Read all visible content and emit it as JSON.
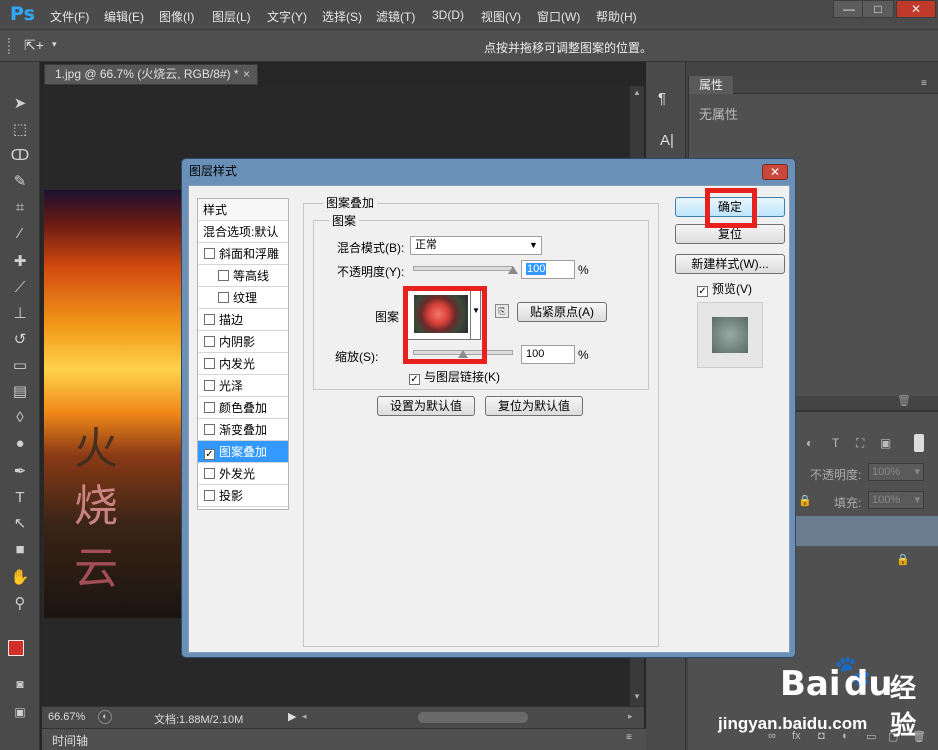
{
  "app": {
    "logo": "Ps"
  },
  "menu": [
    "文件(F)",
    "编辑(E)",
    "图像(I)",
    "图层(L)",
    "文字(Y)",
    "选择(S)",
    "滤镜(T)",
    "3D(D)",
    "视图(V)",
    "窗口(W)",
    "帮助(H)"
  ],
  "window_controls": {
    "minimize": "—",
    "maximize": "□",
    "close": "✕"
  },
  "options_bar": {
    "hint": "点按并拖移可调整图案的位置。"
  },
  "document": {
    "tab_title": "1.jpg @ 66.7% (火烧云, RGB/8#) *",
    "tab_close": "×",
    "canvas_text": [
      "火",
      "烧",
      "云"
    ]
  },
  "status": {
    "zoom": "66.67%",
    "doc_info": "文档:1.88M/2.10M"
  },
  "timeline": {
    "label": "时间轴"
  },
  "properties": {
    "tab": "属性",
    "empty": "无属性"
  },
  "layers": {
    "opacity_label": "不透明度:",
    "opacity_value": "100%",
    "fill_label": "填充:",
    "fill_value": "100%"
  },
  "dialog": {
    "title": "图层样式",
    "close": "✕",
    "styles_header": "样式",
    "blend_options": "混合选项:默认",
    "styles": [
      {
        "label": "斜面和浮雕",
        "checked": false,
        "sub": false
      },
      {
        "label": "等高线",
        "checked": false,
        "sub": true
      },
      {
        "label": "纹理",
        "checked": false,
        "sub": true
      },
      {
        "label": "描边",
        "checked": false,
        "sub": false
      },
      {
        "label": "内阴影",
        "checked": false,
        "sub": false
      },
      {
        "label": "内发光",
        "checked": false,
        "sub": false
      },
      {
        "label": "光泽",
        "checked": false,
        "sub": false
      },
      {
        "label": "颜色叠加",
        "checked": false,
        "sub": false
      },
      {
        "label": "渐变叠加",
        "checked": false,
        "sub": false
      },
      {
        "label": "图案叠加",
        "checked": true,
        "sub": false,
        "selected": true
      },
      {
        "label": "外发光",
        "checked": false,
        "sub": false
      },
      {
        "label": "投影",
        "checked": false,
        "sub": false
      }
    ],
    "section_title": "图案叠加",
    "group_title": "图案",
    "blend_mode_label": "混合模式(B):",
    "blend_mode_value": "正常",
    "opacity_label": "不透明度(Y):",
    "opacity_value": "100",
    "opacity_unit": "%",
    "opacity_level": 1.0,
    "pattern_label": "图案",
    "snap_button": "贴紧原点(A)",
    "scale_label": "缩放(S):",
    "scale_value": "100",
    "scale_unit": "%",
    "scale_level": 0.5,
    "link_checkbox": "与图层链接(K)",
    "link_checked": true,
    "set_default": "设置为默认值",
    "reset_default": "复位为默认值",
    "ok": "确定",
    "reset": "复位",
    "new_style": "新建样式(W)...",
    "preview_label": "预览(V)",
    "preview_checked": true
  },
  "watermark": {
    "brand": "Bai",
    "brand2": "du",
    "cn": "经验",
    "url": "jingyan.baidu.com"
  },
  "colors": {
    "menubar": "#4b4b4b",
    "dialog_frame": "#6a90b8",
    "selected_style": "#3399ff",
    "annotation": "#e8201e"
  }
}
